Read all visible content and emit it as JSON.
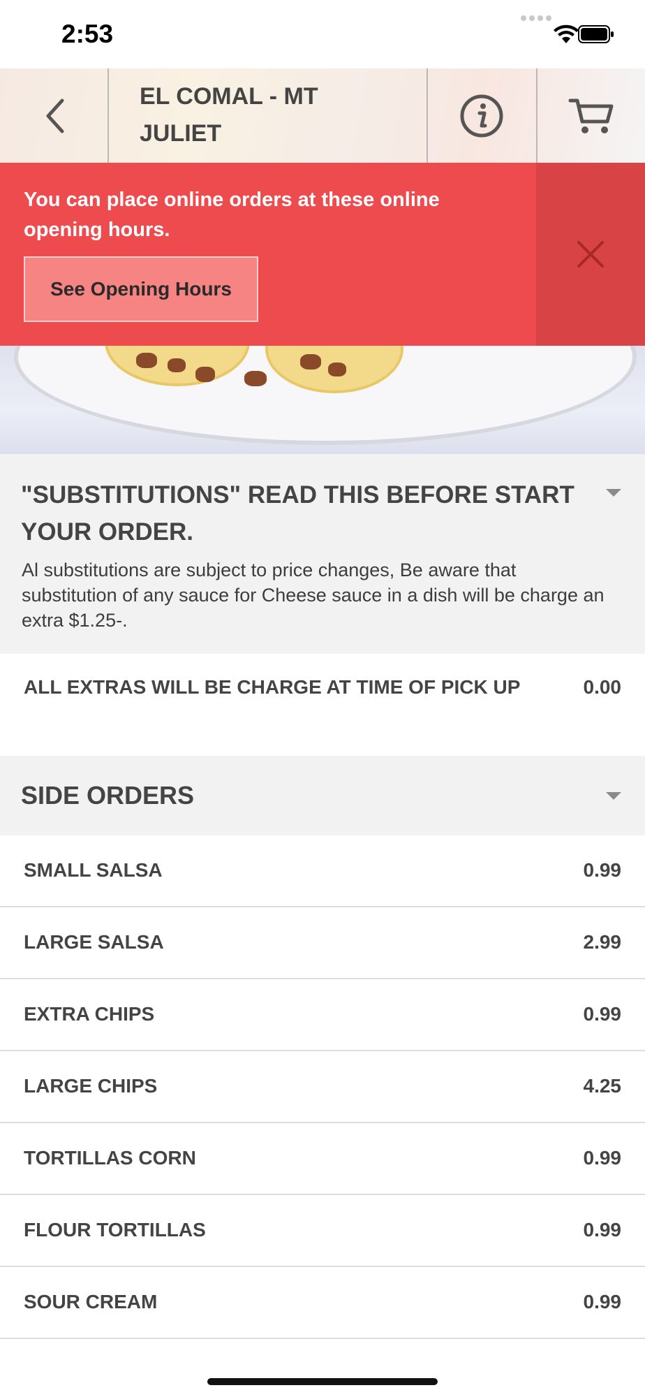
{
  "status_bar": {
    "time": "2:53"
  },
  "header": {
    "title": "EL COMAL - MT JULIET",
    "back_icon": "chevron-left-icon",
    "info_icon": "info-icon",
    "cart_icon": "cart-icon"
  },
  "banner": {
    "message": "You can place online orders at these online opening hours.",
    "button_label": "See Opening Hours",
    "close_icon": "close-icon",
    "background": "#ee4b4e"
  },
  "sections": [
    {
      "title": "\"SUBSTITUTIONS\" READ THIS BEFORE START YOUR ORDER.",
      "description": "Al substitutions are subject to price changes, Be aware that substitution of any sauce for Cheese sauce in a dish will be charge an extra $1.25-.",
      "items": [
        {
          "name": "ALL EXTRAS WILL BE CHARGE AT TIME OF PICK UP",
          "price": "0.00"
        }
      ]
    },
    {
      "title": "SIDE ORDERS",
      "items": [
        {
          "name": "SMALL SALSA",
          "price": "0.99"
        },
        {
          "name": "LARGE SALSA",
          "price": "2.99"
        },
        {
          "name": "EXTRA CHIPS",
          "price": "0.99"
        },
        {
          "name": "LARGE CHIPS",
          "price": "4.25"
        },
        {
          "name": "TORTILLAS CORN",
          "price": "0.99"
        },
        {
          "name": "FLOUR TORTILLAS",
          "price": "0.99"
        },
        {
          "name": "SOUR CREAM",
          "price": "0.99"
        }
      ]
    }
  ]
}
